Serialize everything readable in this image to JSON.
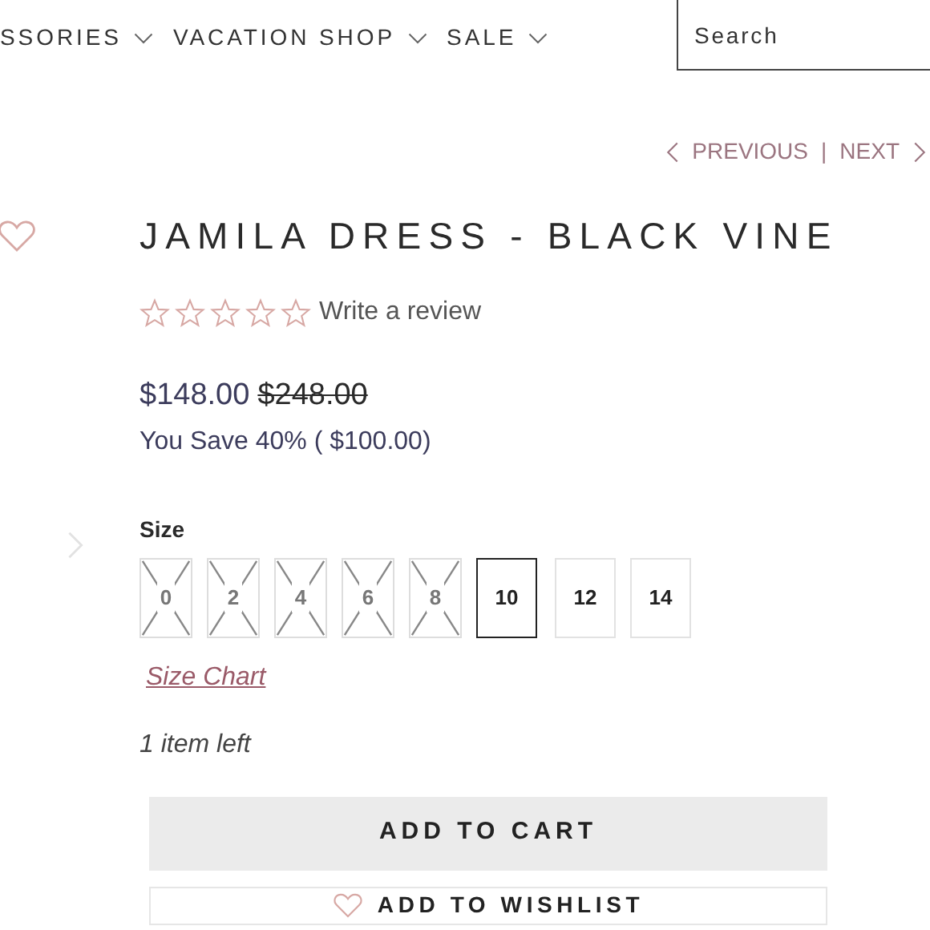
{
  "nav": {
    "items": [
      {
        "label": "SSORIES"
      },
      {
        "label": "VACATION SHOP"
      },
      {
        "label": "SALE"
      }
    ],
    "search": {
      "placeholder": "Search"
    }
  },
  "pager": {
    "previous": "PREVIOUS",
    "separator": "|",
    "next": "NEXT"
  },
  "product": {
    "title": "JAMILA DRESS - BLACK VINE",
    "stars": 0,
    "review_link": "Write a review",
    "price": "$148.00",
    "old_price": "$248.00",
    "savings": "You Save 40% ( $100.00)",
    "size_label": "Size",
    "sizes": [
      {
        "label": "0",
        "selected": false,
        "disabled": true
      },
      {
        "label": "2",
        "selected": false,
        "disabled": true
      },
      {
        "label": "4",
        "selected": false,
        "disabled": true
      },
      {
        "label": "6",
        "selected": false,
        "disabled": true
      },
      {
        "label": "8",
        "selected": false,
        "disabled": true
      },
      {
        "label": "10",
        "selected": true,
        "disabled": false
      },
      {
        "label": "12",
        "selected": false,
        "disabled": false
      },
      {
        "label": "14",
        "selected": false,
        "disabled": false
      }
    ],
    "size_chart": "Size Chart",
    "stock": "1 item left",
    "add_to_cart": "ADD TO CART",
    "add_to_wishlist": "ADD TO WISHLIST"
  }
}
